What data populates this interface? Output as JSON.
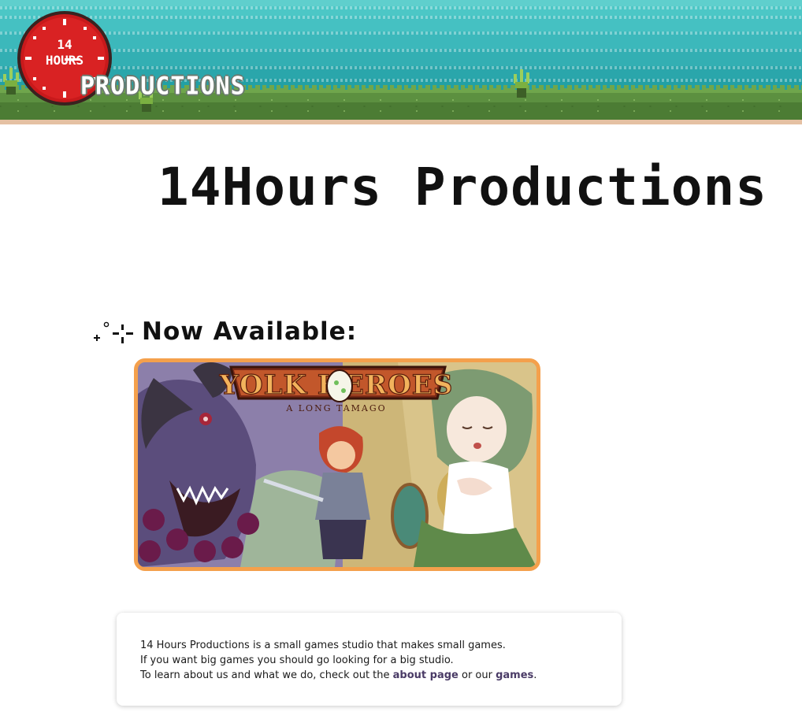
{
  "banner": {
    "logo_line1": "14",
    "logo_line2": "HOURS",
    "logo_word": "PRODUCTIONS",
    "colors": {
      "sky": "#3cb8bb",
      "grass": "#5c9040",
      "sand": "#e5c1a3",
      "clock_red": "#c8191b"
    }
  },
  "page": {
    "title": "14Hours Productions",
    "featured_heading": "Now Available:"
  },
  "featured_game": {
    "logo_title": "YOLK HEROES",
    "logo_subtitle": "A LONG TAMAGO",
    "frame_color": "#f4a04c"
  },
  "intro": {
    "line1": "14 Hours Productions is a small games studio that makes small games.",
    "line2": "If you want big games you should go looking for a big studio.",
    "line3_prefix": "To learn about us and what we do, check out the ",
    "about_link": "about page",
    "line3_middle": " or our ",
    "games_link": "games",
    "line3_suffix": "."
  }
}
